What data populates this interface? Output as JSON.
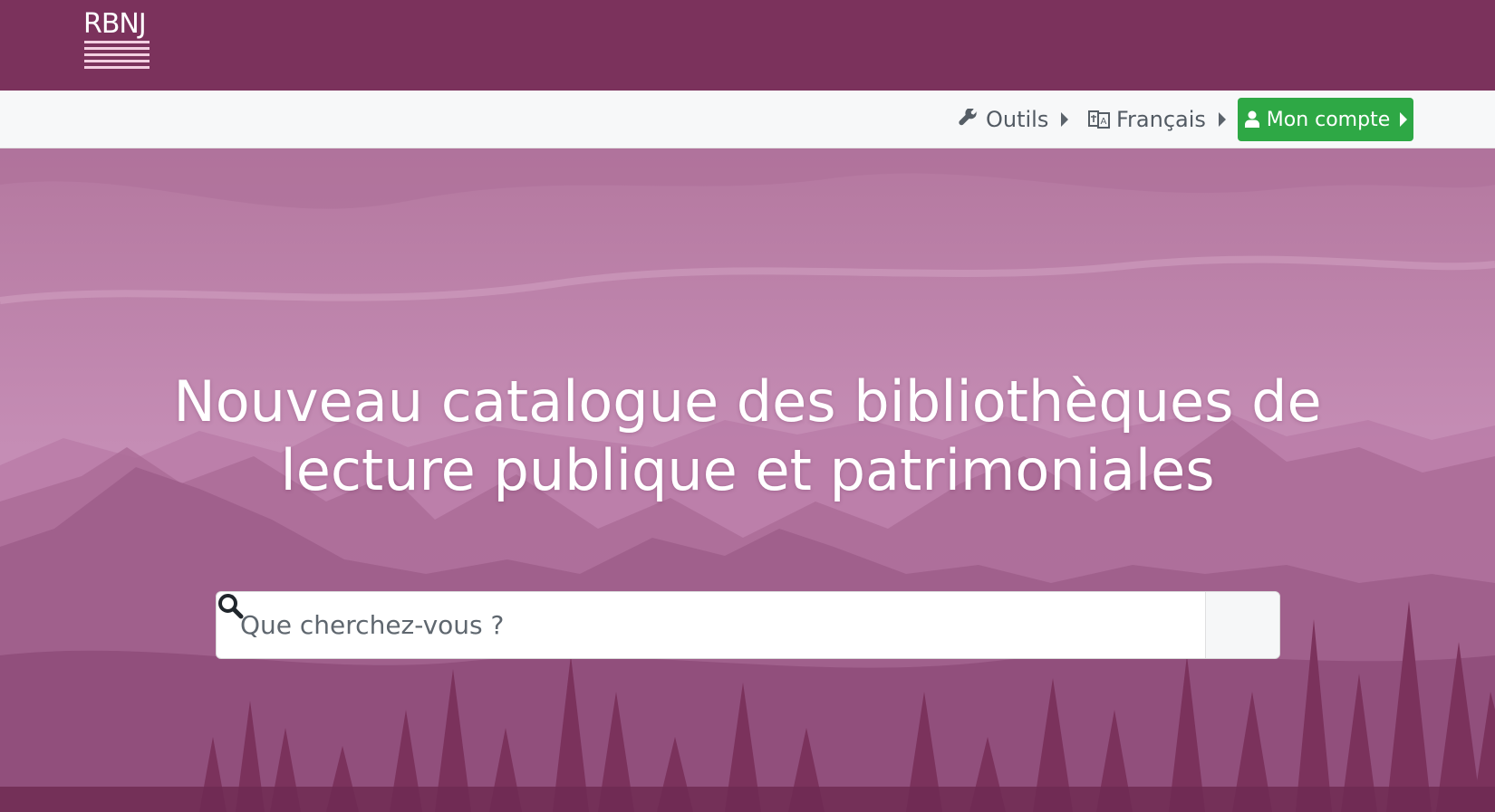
{
  "header": {
    "logo_text": "RBNJ",
    "background": "#7b325c"
  },
  "nav": {
    "tools": {
      "label": "Outils",
      "icon": "wrench-icon"
    },
    "language": {
      "label": "Français",
      "icon": "language-icon"
    },
    "account": {
      "label": "Mon compte",
      "icon": "user-icon",
      "color": "#2ea845"
    }
  },
  "hero": {
    "headline_line1": "Nouveau catalogue des bibliothèques de",
    "headline_line2": "lecture publique et patrimoniales",
    "search_placeholder": "Que cherchez-vous ?",
    "search_icon": "search-icon",
    "tint": "#bf84ad"
  }
}
